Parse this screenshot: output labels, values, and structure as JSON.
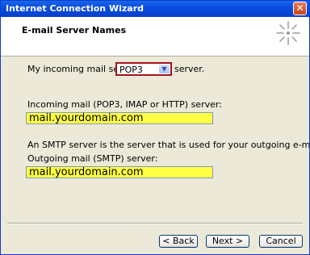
{
  "window": {
    "title": "Internet Connection Wizard",
    "close_glyph": "✕"
  },
  "header": {
    "title": "E-mail Server Names",
    "icon": "wizard-sparkle-icon"
  },
  "incoming_type": {
    "prefix": "My incoming mail server is a",
    "selected": "POP3",
    "suffix": "server."
  },
  "incoming": {
    "label": "Incoming mail (POP3, IMAP or HTTP) server:",
    "value": "mail.yourdomain.com"
  },
  "smtp_note": "An SMTP server is the server that is used for your outgoing e-mail.",
  "outgoing": {
    "label": "Outgoing mail (SMTP) server:",
    "value": "mail.yourdomain.com"
  },
  "buttons": {
    "back": "< Back",
    "next": "Next >",
    "cancel": "Cancel"
  },
  "colors": {
    "title_bar": "#0a4ee0",
    "highlight": "#ffff44",
    "select_border": "#a3131c",
    "dialog_bg": "#ece9d8"
  }
}
